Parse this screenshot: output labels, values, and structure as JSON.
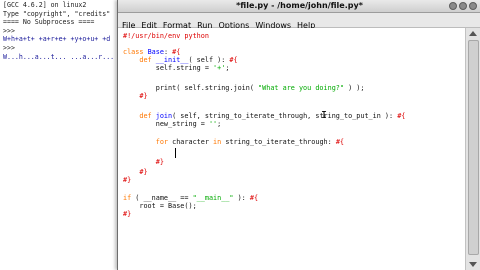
{
  "shell": {
    "lines": [
      "[GCC 4.6.2] on linux2",
      "Type \"copyright\", \"credits\"",
      "==== No Subprocess ====",
      ">>>",
      "W+h+a+t+ +a+r+e+ +y+o+u+ +d",
      ">>>",
      "W...h...a...t... ...a...r..."
    ]
  },
  "editor": {
    "title": "*file.py - /home/john/file.py*",
    "menu": [
      "File",
      "Edit",
      "Format",
      "Run",
      "Options",
      "Windows",
      "Help"
    ],
    "code": [
      "#!/usr/bin/env python",
      "",
      "class Base: #{",
      "    def __init__( self ): #{",
      "        self.string = '+';",
      "",
      "        print( self.string.join( \"What are you doing?\" ) );",
      "    #}",
      "",
      "    def join( self, string_to_iterate_through, string_to_put_in ): #{",
      "        new_string = '';",
      "",
      "        for character in string_to_iterate_through: #{",
      "",
      "",
      "        #}",
      "    #}",
      "#}",
      "",
      "if ( __name__ == \"__main__\" ): #{",
      "    root = Base();",
      "#}"
    ]
  },
  "colors": {
    "keyword": "#ff7700",
    "builtin_name": "#0000ff",
    "string": "#00aa00",
    "comment": "#dd0000"
  }
}
